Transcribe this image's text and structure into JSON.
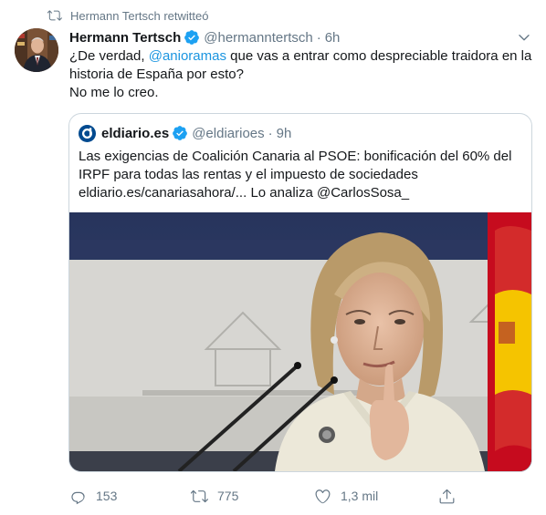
{
  "retweet": {
    "label": "Hermann Tertsch retwitteó"
  },
  "tweet": {
    "author_name": "Hermann Tertsch",
    "handle": "@hermanntertsch",
    "separator": "·",
    "time": "6h",
    "text_part1": "¿De verdad, ",
    "mention": "@anioramas",
    "text_part2": " que vas a entrar como despreciable traidora en la historia de España por esto?",
    "text_line3": "No me lo creo."
  },
  "quote": {
    "name": "eldiario.es",
    "handle": "@eldiarioes",
    "separator": "·",
    "time": "9h",
    "text": "Las exigencias de Coalición Canaria al PSOE: bonificación del 60% del IRPF para todas las rentas y el impuesto de sociedades eldiario.es/canariasahora/... Lo analiza @CarlosSosa_"
  },
  "actions": {
    "replies": "153",
    "retweets": "775",
    "likes": "1,3 mil"
  },
  "colors": {
    "accent": "#1da1f2",
    "mention": "#1b95e0",
    "muted": "#657786",
    "border": "#ccd6dd"
  },
  "icons": [
    "retweet-icon",
    "verified-icon",
    "chevron-down-icon",
    "eldiario-logo-icon",
    "reply-icon",
    "retweet-action-icon",
    "like-icon",
    "share-icon"
  ]
}
